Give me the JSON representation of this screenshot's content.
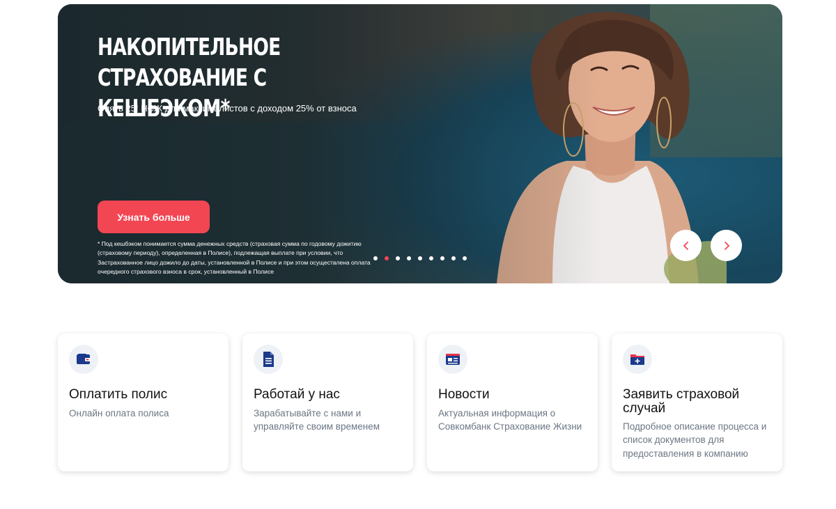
{
  "hero": {
    "title_line1": "НАКОПИТЕЛЬНОЕ",
    "title_line2": "СТРАХОВАНИЕ С КЕШБЭКОМ*",
    "subtitle": "Опять 25! НСЖ для максималистов с доходом 25% от взноса",
    "button_label": "Узнать больше",
    "footnote": "* Под кешбэком понимается сумма денежных средств (страховая сумма по годовому дожитию (страховому периоду), определенная в Полисе), подлежащая выплате при условии, что Застрахованное лицо дожило до даты, установленной в Полисе и при этом осуществлена оплата очередного страхового взноса в срок, установленный в Полисе",
    "slides_total": 9,
    "active_slide": 2,
    "prev_icon": "chevron-left-icon",
    "next_icon": "chevron-right-icon"
  },
  "cards": [
    {
      "icon": "wallet-icon",
      "title": "Оплатить полис",
      "desc": "Онлайн оплата полиса"
    },
    {
      "icon": "document-icon",
      "title": "Работай у нас",
      "desc": "Зарабатывайте с нами и управляйте своим временем"
    },
    {
      "icon": "news-icon",
      "title": "Новости",
      "desc": "Актуальная информация о Совкомбанк Страхование Жизни"
    },
    {
      "icon": "folder-plus-icon",
      "title": "Заявить страховой случай",
      "desc": "Подробное описание процесса и список документов для предоставления в компанию"
    }
  ],
  "colors": {
    "accent": "#f24653",
    "icon_blue": "#1b3a8c",
    "icon_red": "#e8334a",
    "muted_text": "#6b7684"
  }
}
